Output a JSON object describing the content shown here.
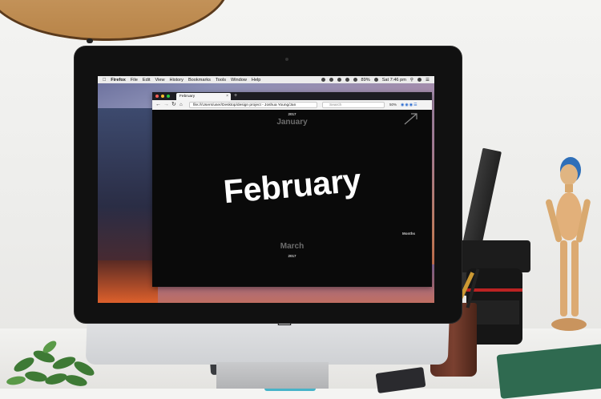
{
  "menubar": {
    "app": "Firefox",
    "items": [
      "File",
      "Edit",
      "View",
      "History",
      "Bookmarks",
      "Tools",
      "Window",
      "Help"
    ],
    "battery": "89%",
    "clock": "Sat 7:46 pm"
  },
  "browser": {
    "tab_title": "February",
    "url": "file:///Users/user/Desktop/design project - Joshua Young/Jan",
    "search_placeholder": "Search",
    "zoom": "50%"
  },
  "page": {
    "year_top": "2017",
    "previous_month": "January",
    "current_month": "February",
    "next_month": "March",
    "year_bottom": "2017",
    "nav_link": "Months"
  }
}
